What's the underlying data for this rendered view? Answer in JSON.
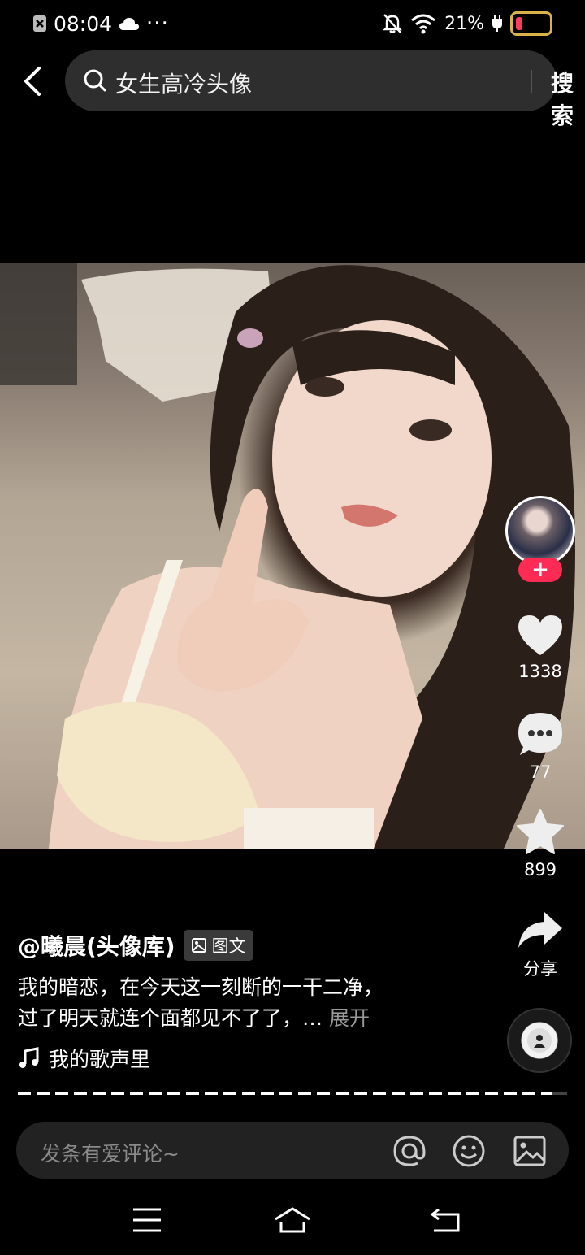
{
  "status_bar": {
    "time": "08:04",
    "battery": "21%",
    "battery_level": 0.21
  },
  "search": {
    "query": "女生高冷头像",
    "button_label": "搜索"
  },
  "rail": {
    "follow_label": "+",
    "like_count": "1338",
    "comment_count": "77",
    "favorite_count": "899",
    "share_label": "分享"
  },
  "post": {
    "author": "@曦晨(头像库)",
    "type_tag": "图文",
    "desc_line1": "我的暗恋，在今天这一刻断的一干二净，",
    "desc_line2": "过了明天就连个面都见不了了，… ",
    "expand_label": "展开",
    "music": "我的歌声里"
  },
  "comment_bar": {
    "placeholder": "发条有爱评论~"
  },
  "icons": {
    "back": "chevron-left-icon",
    "search": "search-icon",
    "like": "heart-icon",
    "comment": "comment-icon",
    "favorite": "star-icon",
    "share": "share-icon",
    "music": "music-note-icon",
    "mention": "at-icon",
    "emoji": "emoji-icon",
    "image": "image-icon"
  },
  "colors": {
    "accent": "#fe2c55",
    "battery_low": "#ff3b5c"
  }
}
